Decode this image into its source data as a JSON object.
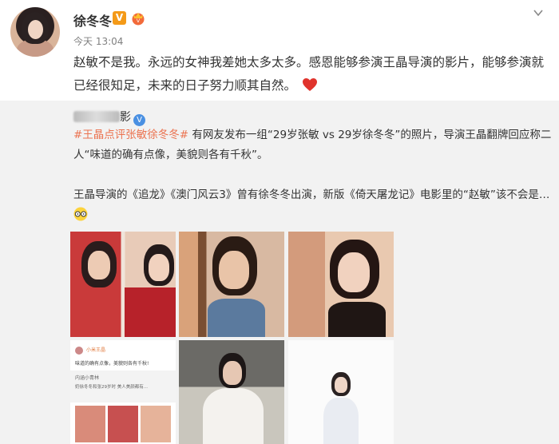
{
  "post": {
    "username": "徐冬冬",
    "verified_mark": "V",
    "time": "今天 13:04",
    "text": "赵敏不是我。永远的女神我差她太多太多。感恩能够参演王晶导演的影片，能够参演就已经很知足，未来的日子努力顺其自然。",
    "heart_icon": "red-heart-icon"
  },
  "repost": {
    "user_suffix": "影",
    "verified_mark": "V",
    "topic": "#王晶点评张敏徐冬冬#",
    "paragraph1": "有网友发布一组“29岁张敏 vs 29岁徐冬冬”的照片，导演王晶翻牌回应称二人“味道的确有点像，美貌则各有千秋”。",
    "paragraph2": "王晶导演的《追龙》《澳门风云3》曾有徐冬冬出演，新版《倚天屠龙记》电影里的“赵敏”该不会是…",
    "emoji": "glasses-emoji-icon"
  },
  "screenshot_tile": {
    "name": "小米王晶",
    "line1": "味道的确有点像，美貌则各有千秋!",
    "line2": "内涵小青林",
    "line3": "奶徐冬冬和张29岁时 美人美颜都有..."
  },
  "colors": {
    "topic": "#eb7350",
    "repost_bg": "#f2f2f2",
    "verified_badge": "#f49a18"
  }
}
